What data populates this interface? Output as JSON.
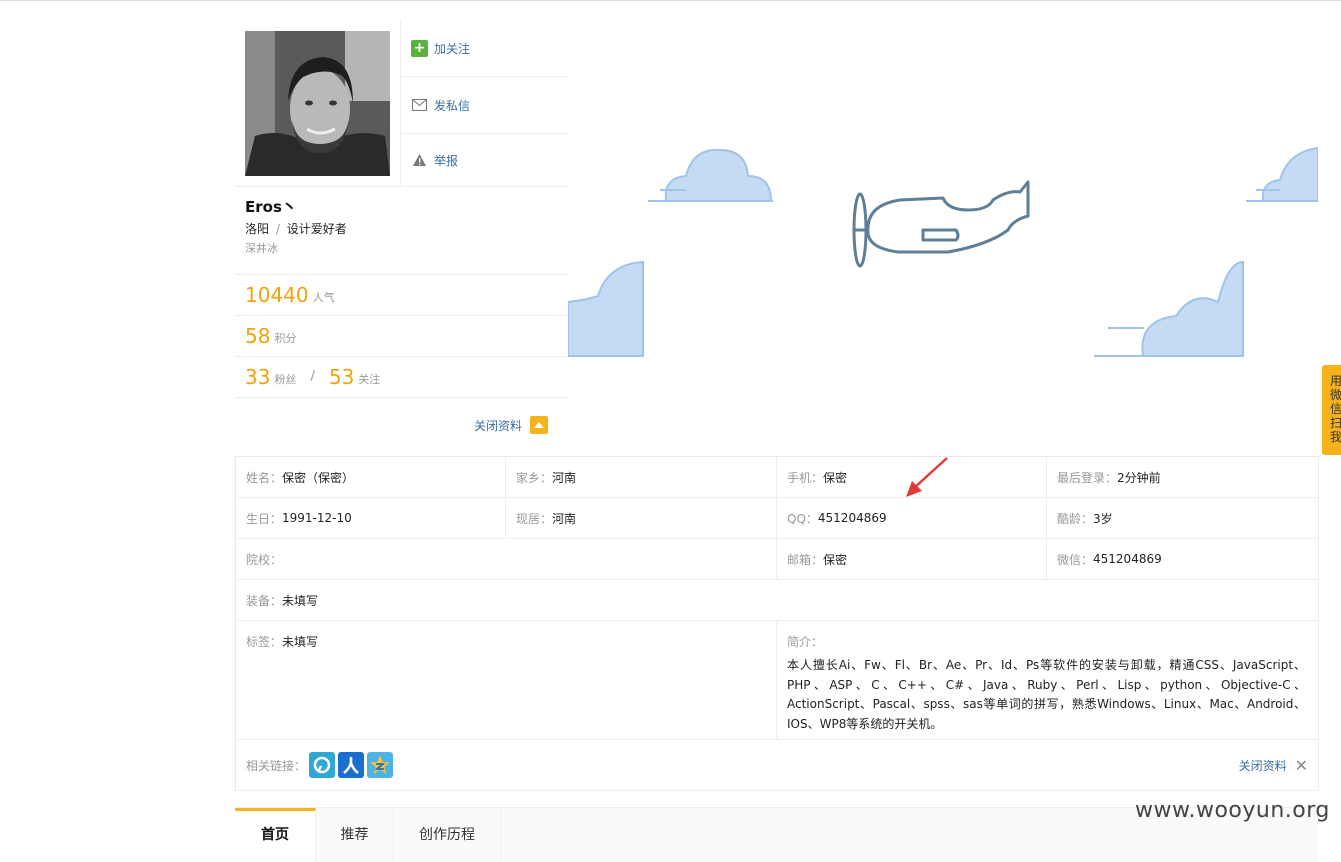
{
  "profile": {
    "actions": {
      "follow": "加关注",
      "message": "发私信",
      "report": "举报"
    },
    "username": "Eros丶",
    "city": "洛阳",
    "loc_sep": "/",
    "occupation": "设计爱好者",
    "sub": "深井冰",
    "popularity": {
      "value": "10440",
      "label": "人气"
    },
    "points": {
      "value": "58",
      "label": "积分"
    },
    "fans": {
      "value": "33",
      "label": "粉丝"
    },
    "follow_sep": "/",
    "following": {
      "value": "53",
      "label": "关注"
    },
    "close_label": "关闭资料"
  },
  "info": {
    "name": {
      "k": "姓名：",
      "v": "保密（保密）"
    },
    "hometown": {
      "k": "家乡：",
      "v": "河南"
    },
    "phone": {
      "k": "手机：",
      "v": "保密"
    },
    "last_login": {
      "k": "最后登录：",
      "v": "2分钟前"
    },
    "birthday": {
      "k": "生日：",
      "v": "1991-12-10"
    },
    "residence": {
      "k": "现居：",
      "v": "河南"
    },
    "qq": {
      "k": "QQ：",
      "v": "451204869"
    },
    "age": {
      "k": "酷龄：",
      "v": "3岁"
    },
    "school": {
      "k": "院校：",
      "v": ""
    },
    "email": {
      "k": "邮箱：",
      "v": "保密"
    },
    "wechat": {
      "k": "微信：",
      "v": "451204869"
    },
    "equipment": {
      "k": "装备：",
      "v": "未填写"
    },
    "tags": {
      "k": "标签：",
      "v": "未填写"
    },
    "intro": {
      "k": "简介：",
      "v": "本人擅长Ai、Fw、Fl、Br、Ae、Pr、Id、Ps等软件的安装与卸载，精通CSS、JavaScript、PHP、ASP、C、C++、C#、Java、Ruby、Perl、Lisp、python、Objective-C、ActionScript、Pascal、spss、sas等单词的拼写，熟悉Windows、Linux、Mac、Android、IOS、WP8等系统的开关机。"
    },
    "links": {
      "k": "相关链接："
    },
    "close_label": "关闭资料"
  },
  "tabs": [
    "首页",
    "推荐",
    "创作历程"
  ],
  "float_button": "用微信扫我",
  "watermark": "www.wooyun.org",
  "colors": {
    "accent": "#f5b21b",
    "link": "#3a6ea5",
    "stat": "#f0a30a",
    "cloud": "#c5dbf3"
  }
}
